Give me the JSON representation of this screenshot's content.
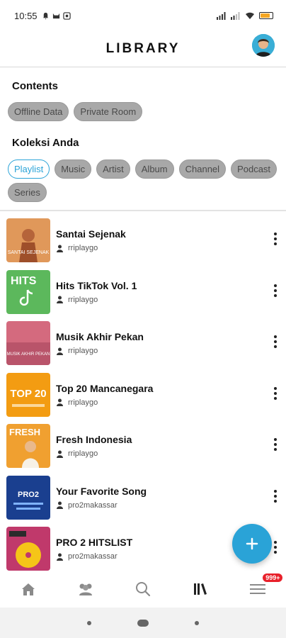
{
  "status_bar": {
    "time": "10:55"
  },
  "header": {
    "title": "LIBRARY"
  },
  "contents": {
    "title": "Contents",
    "chips": [
      "Offline Data",
      "Private Room"
    ]
  },
  "koleksi": {
    "title": "Koleksi Anda",
    "chips": [
      "Playlist",
      "Music",
      "Artist",
      "Album",
      "Channel",
      "Podcast",
      "Series"
    ],
    "active": "Playlist"
  },
  "playlists": [
    {
      "title": "Santai Sejenak",
      "owner": "rriplaygo",
      "thumb_text": "SANTAI SEJENAK",
      "thumb_color": "#e0985a"
    },
    {
      "title": "Hits TikTok Vol. 1",
      "owner": "rriplaygo",
      "thumb_text": "HITS",
      "thumb_color": "#5cb85c"
    },
    {
      "title": "Musik Akhir Pekan",
      "owner": "rriplaygo",
      "thumb_text": "MUSIK AKHIR PEKAN",
      "thumb_color": "#d46a7e"
    },
    {
      "title": "Top 20 Mancanegara",
      "owner": "rriplaygo",
      "thumb_text": "TOP 20",
      "thumb_color": "#f39c12"
    },
    {
      "title": "Fresh Indonesia",
      "owner": "rriplaygo",
      "thumb_text": "FRESH",
      "thumb_color": "#f0a030"
    },
    {
      "title": "Your Favorite Song",
      "owner": "pro2makassar",
      "thumb_text": "PRO2",
      "thumb_color": "#1a3f8f"
    },
    {
      "title": "PRO 2 HITSLIST",
      "owner": "pro2makassar",
      "thumb_text": "",
      "thumb_color": "#c0396b"
    }
  ],
  "bottom_nav": {
    "items": [
      "home-icon",
      "community-icon",
      "search-icon",
      "library-icon",
      "menu-icon"
    ],
    "badge": "999+"
  },
  "colors": {
    "accent": "#2aa3d7",
    "chip_bg": "#a8a8a8",
    "badge": "#e8202a"
  }
}
